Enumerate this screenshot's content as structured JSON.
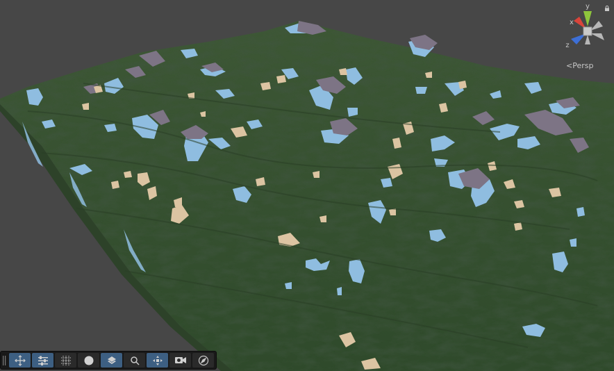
{
  "scene_view": {
    "projection_label": "Persp",
    "gizmo": {
      "axes": [
        "y",
        "x",
        "z"
      ],
      "colors": {
        "y": "#8ec63c",
        "x": "#d9443a",
        "z": "#3d6fd6",
        "center": "#b7b7b7"
      }
    },
    "terrain": {
      "grass_color": "#3b5533",
      "snow_color": "#8fbde0",
      "rock_color": "#7d7485",
      "sand_color": "#dcc4a2"
    }
  },
  "toolbar": {
    "buttons": [
      {
        "name": "move-tool",
        "active": true
      },
      {
        "name": "terrain-settings",
        "active": true
      },
      {
        "name": "grid",
        "active": false
      },
      {
        "name": "sphere-shading",
        "active": false
      },
      {
        "name": "layers",
        "active": true
      },
      {
        "name": "search",
        "active": false
      },
      {
        "name": "snap-move",
        "active": true
      },
      {
        "name": "camera",
        "active": false
      },
      {
        "name": "orientation",
        "active": false
      }
    ]
  }
}
